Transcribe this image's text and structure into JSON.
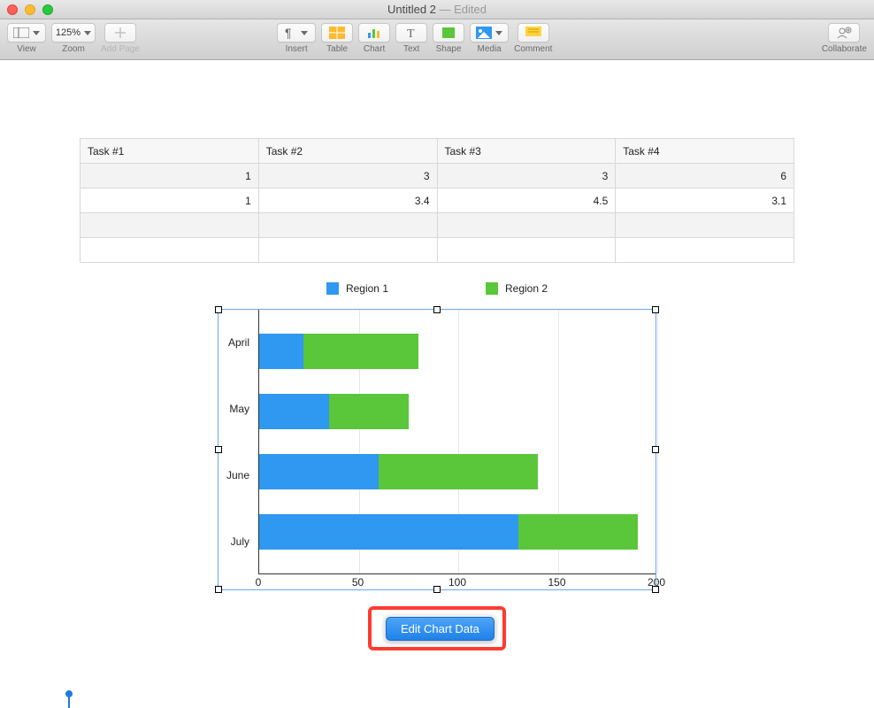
{
  "window": {
    "title": "Untitled 2",
    "edited_suffix": " — Edited"
  },
  "toolbar": {
    "view": "View",
    "zoom_label": "Zoom",
    "zoom_value": "125%",
    "add_page": "Add Page",
    "insert": "Insert",
    "table": "Table",
    "chart": "Chart",
    "text": "Text",
    "shape": "Shape",
    "media": "Media",
    "comment": "Comment",
    "collaborate": "Collaborate"
  },
  "table": {
    "headers": [
      "Task #1",
      "Task #2",
      "Task #3",
      "Task #4"
    ],
    "rows": [
      [
        "1",
        "3",
        "3",
        "6"
      ],
      [
        "1",
        "3.4",
        "4.5",
        "3.1"
      ],
      [
        "",
        "",
        "",
        ""
      ],
      [
        "",
        "",
        "",
        ""
      ]
    ]
  },
  "legend": {
    "r1": "Region 1",
    "r2": "Region 2"
  },
  "chart_data": {
    "type": "bar",
    "orientation": "horizontal",
    "stacked": true,
    "categories": [
      "April",
      "May",
      "June",
      "July"
    ],
    "series": [
      {
        "name": "Region 1",
        "color": "#2f98f1",
        "values": [
          22,
          35,
          60,
          130
        ]
      },
      {
        "name": "Region 2",
        "color": "#5ac639",
        "values": [
          58,
          40,
          80,
          60
        ]
      }
    ],
    "xticks": [
      0,
      50,
      100,
      150,
      200
    ],
    "xlim": [
      0,
      200
    ]
  },
  "edit_button": "Edit Chart Data"
}
